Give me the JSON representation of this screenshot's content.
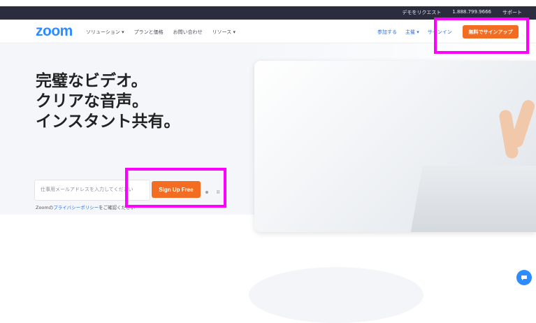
{
  "topbar": {
    "items": [
      "デモをリクエスト",
      "1.888.799.9666",
      "サポート"
    ]
  },
  "nav": {
    "logo": "zoom",
    "left_links": [
      "ソリューション ▾",
      "プランと価格",
      "お問い合わせ",
      "リソース ▾"
    ],
    "right_links": [
      "参加する",
      "主催 ▾",
      "サインイン"
    ],
    "cta_label": "無料でサインアップ"
  },
  "hero": {
    "headline": "完璧なビデオ。\nクリアな音声。\nインスタント共有。",
    "email_placeholder": "仕事用メールアドレスを入力してください",
    "signup_label": "Sign Up Free",
    "pause_label": "II",
    "privacy_prefix": "Zoomの",
    "privacy_link": "プライバシーポリシー",
    "privacy_suffix": "をご確認ください"
  },
  "colors": {
    "accent": "#f26d21",
    "brand": "#2d8cff",
    "topbar": "#2b2d3f",
    "highlight": "#ff00ff"
  },
  "icons": {
    "chat": "chat-bubble-icon"
  }
}
